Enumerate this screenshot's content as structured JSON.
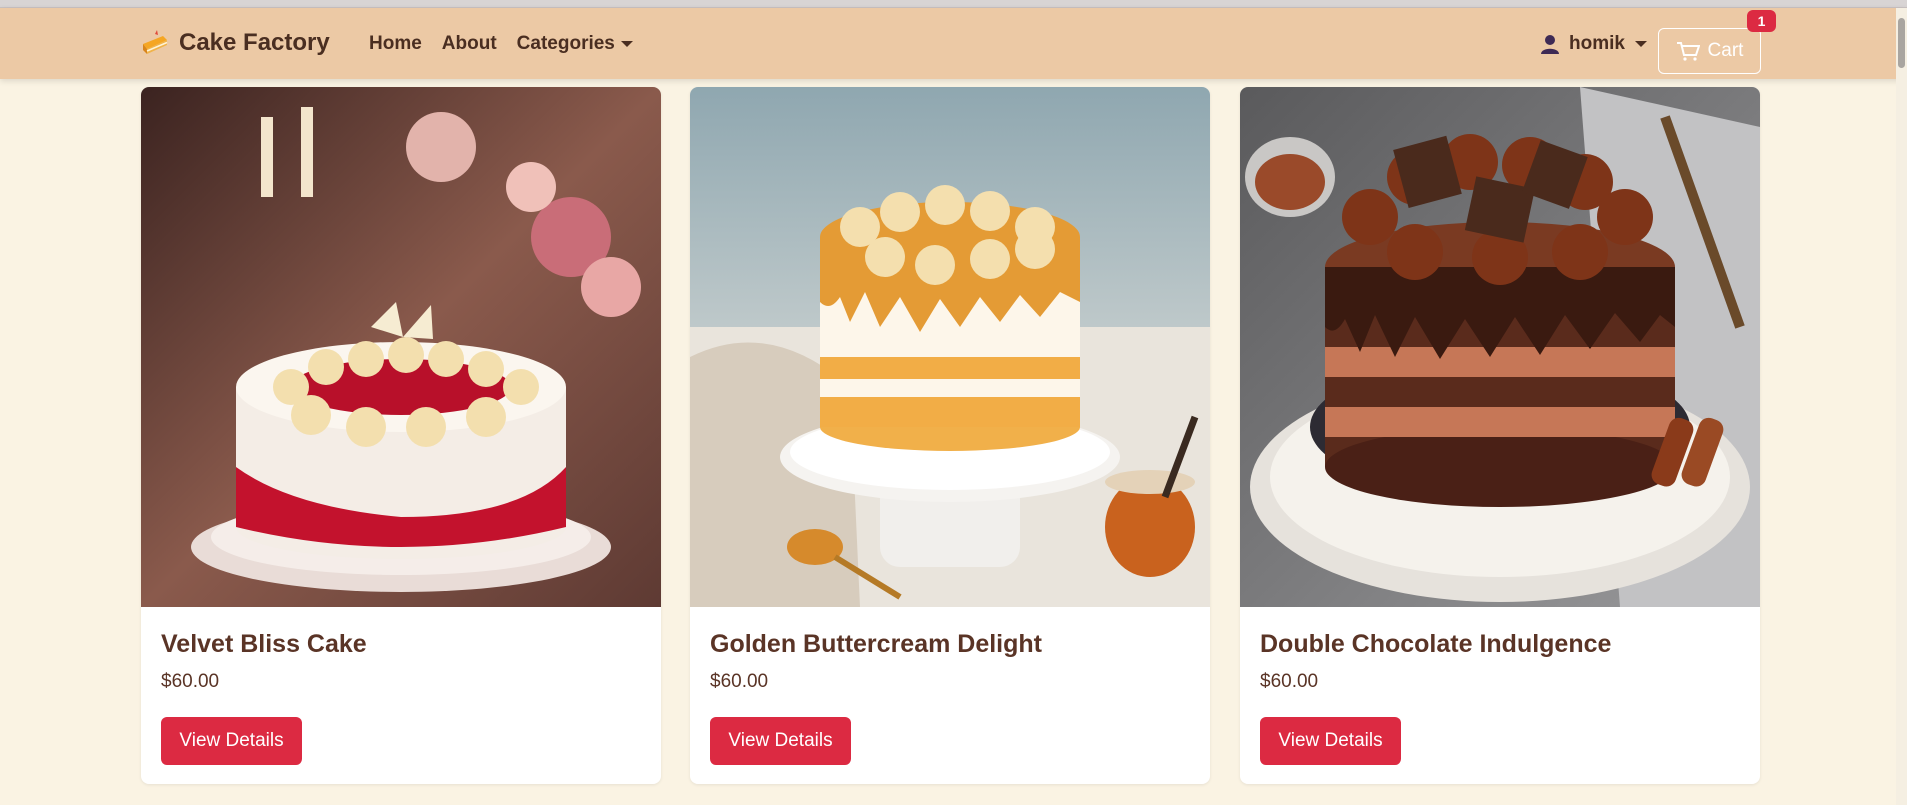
{
  "navbar": {
    "brand": "Cake Factory",
    "links": [
      "Home",
      "About",
      "Categories"
    ],
    "user": "homik",
    "cart_label": "Cart",
    "cart_count": "1"
  },
  "products": [
    {
      "name": "Velvet Bliss Cake",
      "price": "$60.00",
      "button": "View Details"
    },
    {
      "name": "Golden Buttercream Delight",
      "price": "$60.00",
      "button": "View Details"
    },
    {
      "name": "Double Chocolate Indulgence",
      "price": "$60.00",
      "button": "View Details"
    }
  ],
  "colors": {
    "navbar_bg": "#ecc9a5",
    "page_bg": "#faf3e3",
    "accent": "#dc2a42",
    "text": "#4a2e21"
  }
}
